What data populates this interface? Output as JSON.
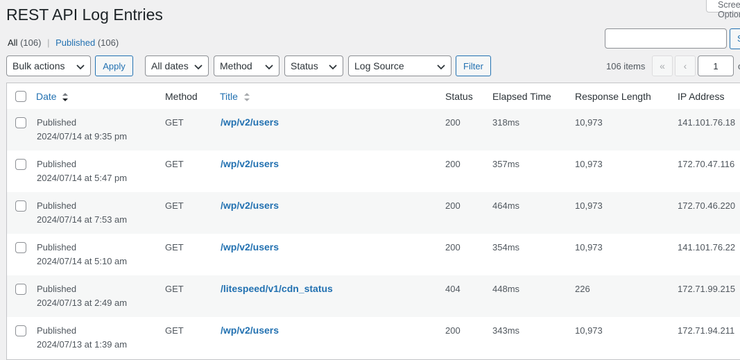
{
  "page": {
    "title": "REST API Log Entries",
    "screen_options": "Screen Options"
  },
  "views": {
    "all_label": "All",
    "all_count": "(106)",
    "separator": "|",
    "published_label": "Published",
    "published_count": "(106)"
  },
  "search": {
    "value": "",
    "button": "Search"
  },
  "toolbar": {
    "bulk_actions": "Bulk actions",
    "apply": "Apply",
    "dates": "All dates",
    "method": "Method",
    "status": "Status",
    "log_source": "Log Source",
    "filter": "Filter"
  },
  "pagination": {
    "items": "106 items",
    "first": "«",
    "prev": "‹",
    "current_page": "1",
    "of": "of"
  },
  "table": {
    "headers": {
      "date": "Date",
      "method": "Method",
      "title": "Title",
      "status": "Status",
      "elapsed": "Elapsed Time",
      "length": "Response Length",
      "ip": "IP Address"
    },
    "rows": [
      {
        "status_label": "Published",
        "datetime": "2024/07/14 at 9:35 pm",
        "method": "GET",
        "title": "/wp/v2/users",
        "status": "200",
        "elapsed": "318ms",
        "length": "10,973",
        "ip": "141.101.76.18"
      },
      {
        "status_label": "Published",
        "datetime": "2024/07/14 at 5:47 pm",
        "method": "GET",
        "title": "/wp/v2/users",
        "status": "200",
        "elapsed": "357ms",
        "length": "10,973",
        "ip": "172.70.47.116"
      },
      {
        "status_label": "Published",
        "datetime": "2024/07/14 at 7:53 am",
        "method": "GET",
        "title": "/wp/v2/users",
        "status": "200",
        "elapsed": "464ms",
        "length": "10,973",
        "ip": "172.70.46.220"
      },
      {
        "status_label": "Published",
        "datetime": "2024/07/14 at 5:10 am",
        "method": "GET",
        "title": "/wp/v2/users",
        "status": "200",
        "elapsed": "354ms",
        "length": "10,973",
        "ip": "141.101.76.22"
      },
      {
        "status_label": "Published",
        "datetime": "2024/07/13 at 2:49 am",
        "method": "GET",
        "title": "/litespeed/v1/cdn_status",
        "status": "404",
        "elapsed": "448ms",
        "length": "226",
        "ip": "172.71.99.215"
      },
      {
        "status_label": "Published",
        "datetime": "2024/07/13 at 1:39 am",
        "method": "GET",
        "title": "/wp/v2/users",
        "status": "200",
        "elapsed": "343ms",
        "length": "10,973",
        "ip": "172.71.94.211"
      }
    ]
  },
  "colors": {
    "link": "#2271b1",
    "text": "#50575e",
    "background": "#f0f0f1",
    "row_alt": "#f6f7f7"
  }
}
